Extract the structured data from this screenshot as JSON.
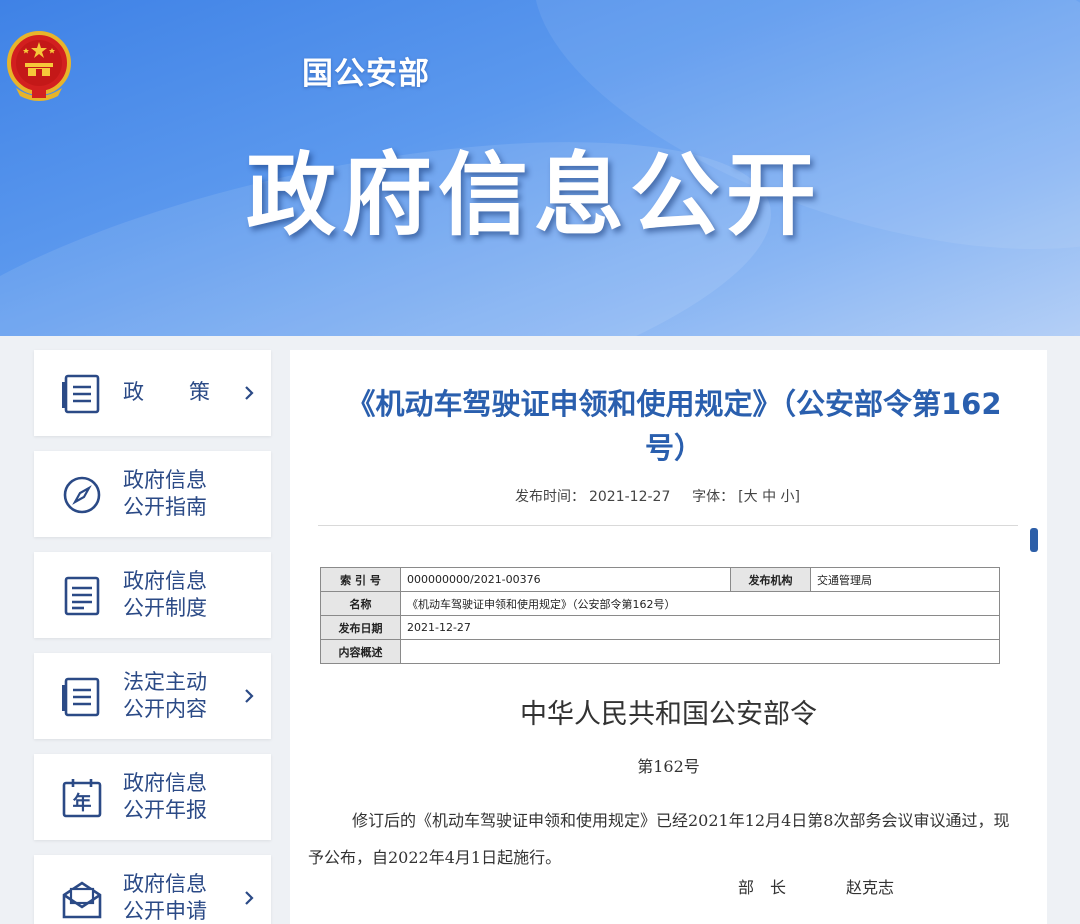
{
  "banner": {
    "ministry_name": "国公安部",
    "title": "政府信息公开"
  },
  "sidebar": {
    "items": [
      {
        "label": "政　　策",
        "icon": "document-list-icon",
        "chevron": true
      },
      {
        "label": "政府信息公开指南",
        "icon": "compass-icon",
        "chevron": false
      },
      {
        "label": "政府信息公开制度",
        "icon": "list-icon",
        "chevron": false
      },
      {
        "label": "法定主动公开内容",
        "icon": "document-list-icon",
        "chevron": true
      },
      {
        "label": "政府信息公开年报",
        "icon": "calendar-year-icon",
        "chevron": false
      },
      {
        "label": "政府信息公开申请",
        "icon": "envelope-icon",
        "chevron": true
      }
    ],
    "lines": [
      [
        "政",
        "策"
      ],
      [
        "政府信息",
        "公开指南"
      ],
      [
        "政府信息",
        "公开制度"
      ],
      [
        "法定主动",
        "公开内容"
      ],
      [
        "政府信息",
        "公开年报"
      ],
      [
        "政府信息",
        "公开申请"
      ]
    ],
    "year_glyph": "年"
  },
  "article": {
    "title_line1": "《机动车驾驶证申领和使用规定》（公安部令第162",
    "title_line2": "号）",
    "publish_label": "发布时间：",
    "publish_date": "2021-12-27",
    "font_label": "字体：",
    "font_sizes": "[大 中 小]",
    "table": {
      "index_label": "索 引 号",
      "index_value": "000000000/2021-00376",
      "org_label": "发布机构",
      "org_value": "交通管理局",
      "name_label": "名称",
      "name_value": "《机动车驾驶证申领和使用规定》（公安部令第162号）",
      "date_label": "发布日期",
      "date_value": "2021-12-27",
      "summary_label": "内容概述",
      "summary_value": ""
    },
    "order_heading": "中华人民共和国公安部令",
    "order_number": "第162号",
    "body": "修订后的《机动车驾驶证申领和使用规定》已经2021年12月4日第8次部务会议审议通过，现予公布，自2022年4月1日起施行。",
    "sign_title": "部　长",
    "sign_name": "赵克志"
  },
  "colors": {
    "banner_blue": "#4a8ae8",
    "nav_text": "#2b4a86",
    "title_blue": "#2a5fae"
  }
}
